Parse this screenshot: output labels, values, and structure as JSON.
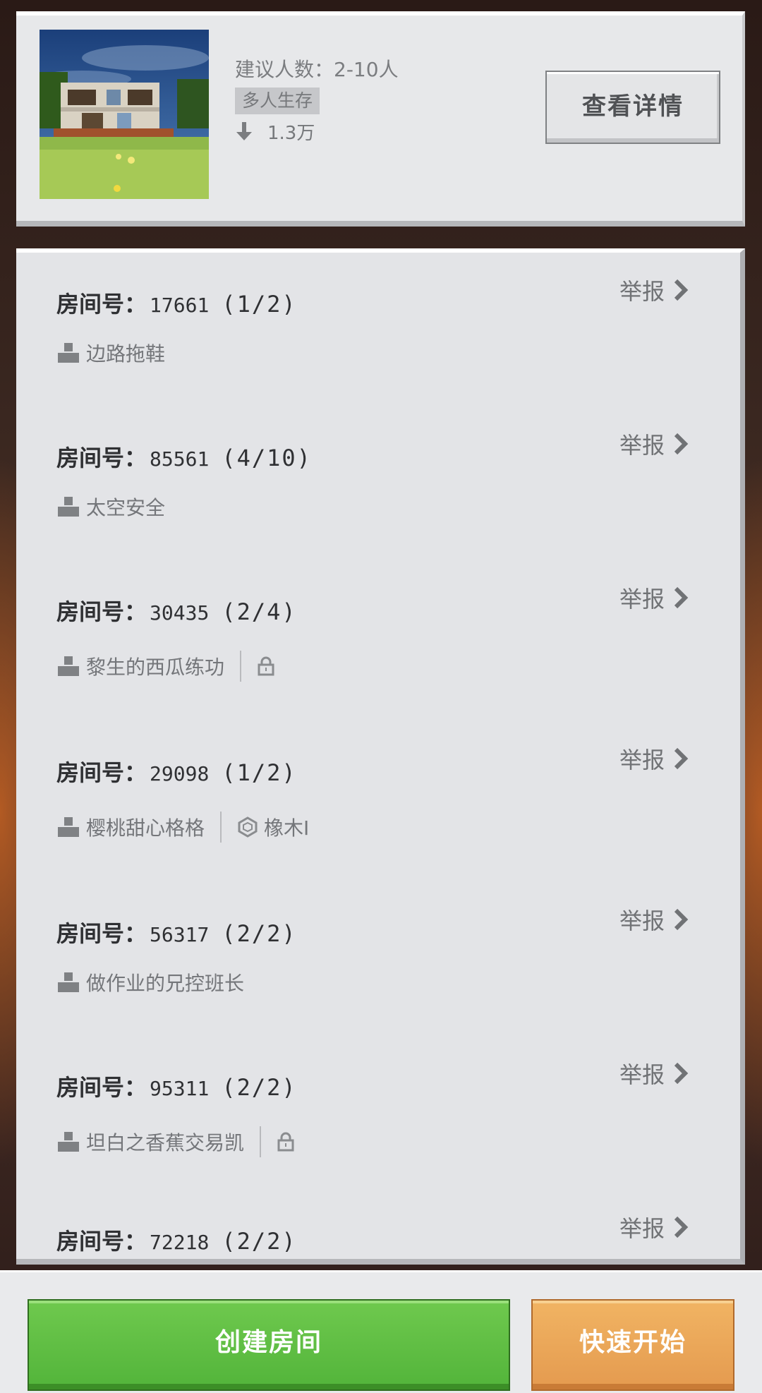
{
  "game": {
    "recommended_players_label": "建议人数：",
    "recommended_players": "2-10人",
    "tag": "多人生存",
    "downloads": "1.3万",
    "details_button": "查看详情",
    "thumbnail_icon": "minecraft-house-thumbnail"
  },
  "rooms": [
    {
      "label": "房间号：",
      "id": "17661",
      "count": "(1/2)",
      "report": "举报",
      "host": "边路拖鞋",
      "locked": false,
      "guild": ""
    },
    {
      "label": "房间号：",
      "id": "85561",
      "count": "(4/10)",
      "report": "举报",
      "host": "太空安全",
      "locked": false,
      "guild": ""
    },
    {
      "label": "房间号：",
      "id": "30435",
      "count": "(2/4)",
      "report": "举报",
      "host": "黎生的西瓜练功",
      "locked": true,
      "guild": ""
    },
    {
      "label": "房间号：",
      "id": "29098",
      "count": "(1/2)",
      "report": "举报",
      "host": "樱桃甜心格格",
      "locked": false,
      "guild": "橡木I"
    },
    {
      "label": "房间号：",
      "id": "56317",
      "count": "(2/2)",
      "report": "举报",
      "host": "做作业的兄控班长",
      "locked": false,
      "guild": ""
    },
    {
      "label": "房间号：",
      "id": "95311",
      "count": "(2/2)",
      "report": "举报",
      "host": "坦白之香蕉交易凯",
      "locked": true,
      "guild": ""
    },
    {
      "label": "房间号：",
      "id": "72218",
      "count": "(2/2)",
      "report": "举报",
      "host": "",
      "locked": false,
      "guild": ""
    }
  ],
  "actions": {
    "create_room": "创建房间",
    "quick_start": "快速开始"
  },
  "colors": {
    "primary_green": "#5bbd40",
    "accent_orange": "#eaa556",
    "card_bg": "#e3e4e7"
  },
  "icons": {
    "host": "user-icon",
    "lock": "lock-icon",
    "guild": "hexagon-badge-icon",
    "download": "download-arrow-icon",
    "report_arrow": "chevron-right-icon"
  }
}
